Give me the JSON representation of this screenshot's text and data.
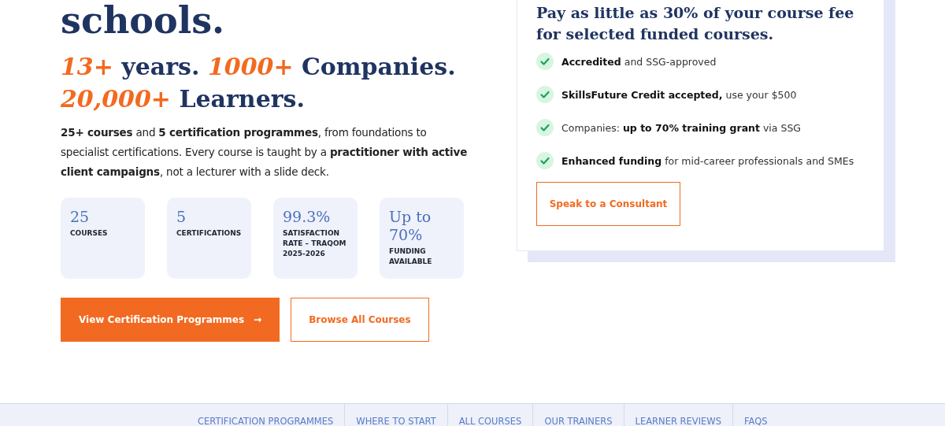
{
  "hero": {
    "title": "schools.",
    "headline": [
      [
        {
          "text": "13+",
          "accent": true
        },
        {
          "text": " years. ",
          "accent": false
        },
        {
          "text": "1000+",
          "accent": true
        },
        {
          "text": " Companies.",
          "accent": false
        }
      ],
      [
        {
          "text": "20,000+",
          "accent": true
        },
        {
          "text": " Learners.",
          "accent": false
        }
      ]
    ],
    "intro": "**25+ courses** and **5 certification programmes**, from foundations to specialist certifications. Every course is taught by a **practitioner with active client campaigns**, not a lecturer with a slide deck.",
    "stats": [
      {
        "value": "25",
        "label": "COURSES"
      },
      {
        "value": "5",
        "label": "CERTIFICATIONS"
      },
      {
        "value": "99.3%",
        "label": "SATISFACTION RATE – TRAQOM 2025-2026"
      },
      {
        "value": "Up to 70%",
        "label": "FUNDING AVAILABLE"
      }
    ],
    "buttons": [
      {
        "label": "View Certification Programmes",
        "arrow": "→",
        "kind": "primary"
      },
      {
        "label": "Browse All Courses",
        "kind": "outline"
      }
    ]
  },
  "funding_card": {
    "heading": "Pay as little as 30% of your course fee for selected funded courses.",
    "points": [
      "**Accredited** and SSG-approved",
      "**SkillsFuture Credit accepted,** use your $500",
      "Companies: **up to 70% training grant** via SSG",
      "**Enhanced funding** for mid-career professionals and SMEs"
    ],
    "button": "Speak to a Consultant"
  },
  "section_nav": [
    "CERTIFICATION PROGRAMMES",
    "WHERE TO START",
    "ALL COURSES",
    "OUR TRAINERS",
    "LEARNER REVIEWS",
    "FAQS"
  ]
}
